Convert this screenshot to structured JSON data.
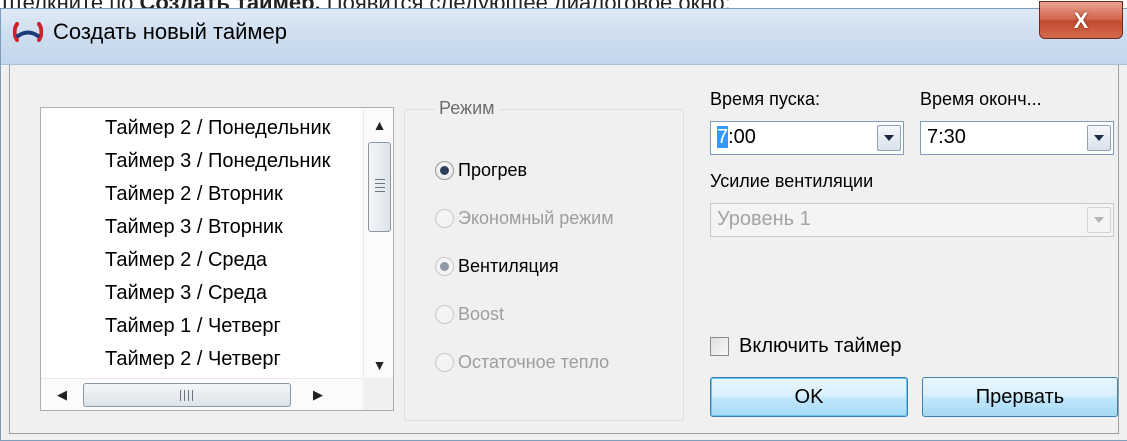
{
  "page_text": {
    "prefix": "Щелкните по ",
    "bold": "Создать таймер.",
    "suffix": " Появится следующее диалоговое окно:"
  },
  "window": {
    "title": "Создать новый таймер",
    "close_label": "X"
  },
  "timer_list": {
    "items": [
      "Таймер 2 / Понедельник",
      "Таймер 3 / Понедельник",
      "Таймер 2 / Вторник",
      "Таймер 3 / Вторник",
      "Таймер 2 / Среда",
      "Таймер 3 / Среда",
      "Таймер 1 / Четверг",
      "Таймер 2 / Четверг"
    ]
  },
  "mode_group": {
    "legend": "Режим",
    "options": [
      {
        "label": "Прогрев",
        "state": "selected"
      },
      {
        "label": "Экономный режим",
        "state": "disabled"
      },
      {
        "label": "Вентиляция",
        "state": "selected-disabled"
      },
      {
        "label": "Boost",
        "state": "disabled"
      },
      {
        "label": "Остаточное тепло",
        "state": "disabled"
      }
    ]
  },
  "start_time": {
    "label": "Время пуска:",
    "value_selected": "7",
    "value_rest": ":00"
  },
  "end_time": {
    "label": "Время оконч...",
    "value": "7:30"
  },
  "ventilation": {
    "label": "Усилие вентиляции",
    "value": "Уровень 1"
  },
  "enable_timer": {
    "label": "Включить таймер",
    "checked": false
  },
  "buttons": {
    "ok": "OK",
    "cancel": "Прервать"
  },
  "colors": {
    "selection": "#3399ff",
    "button_border": "#3c7fb1",
    "close_red": "#c24a32"
  }
}
